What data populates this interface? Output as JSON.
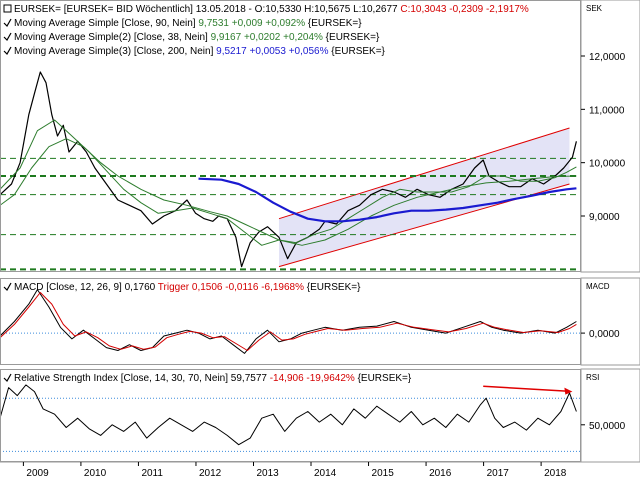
{
  "chart_data": [
    {
      "type": "line",
      "panel": "price",
      "axis_title": "SEK",
      "legend": [
        {
          "text": "EURSEK= [EURSEK= BID Wöchentlich] 13.05.2018 - O:10,5330 H:10,5675 L:10,2677 ",
          "text_colored": "C:10,3043 -0,2309 -2,1917%",
          "color": "#d40000",
          "checkbox": false
        },
        {
          "text": "Moving Average Simple [Close, 90, Nein] ",
          "text_colored": "9,7531 +0,009 +0,092%",
          "tail": " {EURSEK=}",
          "color": "#2e7d2e",
          "checkbox": true
        },
        {
          "text": "Moving Average Simple(2) [Close, 38, Nein] ",
          "text_colored": "9,9167 +0,0202 +0,204%",
          "tail": " {EURSEK=}",
          "color": "#2e7d2e",
          "checkbox": true
        },
        {
          "text": "Moving Average Simple(3) [Close, 200, Nein] ",
          "text_colored": "9,5217 +0,0053 +0,056%",
          "tail": " {EURSEK=}",
          "color": "#1a1ad0",
          "checkbox": true
        }
      ],
      "y_ticks": [
        {
          "value": 12,
          "label": "12,0000"
        },
        {
          "value": 11,
          "label": "11,0000"
        },
        {
          "value": 10,
          "label": "10,0000"
        },
        {
          "value": 9,
          "label": "9,0000"
        }
      ],
      "ylim": [
        7.95,
        13.05
      ],
      "grid": false,
      "horizontal_levels": [
        10.08,
        9.75,
        9.4,
        8.65,
        8.0
      ],
      "series": [
        {
          "id": "price",
          "color": "#000000",
          "x": [
            2008.35,
            2008.55,
            2008.7,
            2008.85,
            2008.95,
            2009.05,
            2009.15,
            2009.25,
            2009.35,
            2009.45,
            2009.55,
            2009.7,
            2009.85,
            2010.0,
            2010.2,
            2010.4,
            2010.6,
            2010.8,
            2011.0,
            2011.2,
            2011.4,
            2011.6,
            2011.75,
            2011.9,
            2012.05,
            2012.15,
            2012.3,
            2012.45,
            2012.55,
            2012.7,
            2012.85,
            2013.0,
            2013.2,
            2013.35,
            2013.5,
            2013.7,
            2013.9,
            2014.0,
            2014.2,
            2014.4,
            2014.6,
            2014.8,
            2015.0,
            2015.2,
            2015.4,
            2015.6,
            2015.8,
            2016.0,
            2016.2,
            2016.4,
            2016.6,
            2016.75,
            2016.85,
            2017.0,
            2017.2,
            2017.4,
            2017.6,
            2017.8,
            2018.0,
            2018.15,
            2018.3,
            2018.37
          ],
          "y": [
            9.4,
            9.6,
            10.0,
            10.9,
            11.3,
            11.7,
            11.5,
            10.9,
            10.5,
            10.7,
            10.2,
            10.4,
            10.2,
            9.9,
            9.6,
            9.3,
            9.2,
            9.1,
            8.85,
            9.0,
            9.1,
            9.3,
            9.05,
            8.95,
            8.9,
            9.0,
            8.95,
            8.6,
            8.05,
            8.5,
            8.7,
            8.8,
            8.6,
            8.2,
            8.5,
            8.6,
            8.75,
            8.9,
            8.85,
            9.1,
            9.2,
            9.4,
            9.5,
            9.45,
            9.35,
            9.5,
            9.4,
            9.35,
            9.5,
            9.6,
            9.9,
            10.05,
            9.75,
            9.65,
            9.55,
            9.55,
            9.7,
            9.6,
            9.75,
            9.9,
            10.1,
            10.4
          ]
        },
        {
          "id": "ma90",
          "color": "#2e7d2e",
          "x": [
            2008.35,
            2008.6,
            2008.9,
            2009.2,
            2009.5,
            2009.8,
            2010.1,
            2010.4,
            2010.8,
            2011.2,
            2011.6,
            2012.0,
            2012.3,
            2012.6,
            2012.9,
            2013.2,
            2013.6,
            2014.0,
            2014.4,
            2014.8,
            2015.2,
            2015.6,
            2016.0,
            2016.4,
            2016.8,
            2017.2,
            2017.6,
            2018.0,
            2018.37
          ],
          "y": [
            9.2,
            9.4,
            9.9,
            10.3,
            10.45,
            10.3,
            10.0,
            9.75,
            9.5,
            9.3,
            9.2,
            9.08,
            9.0,
            8.85,
            8.7,
            8.55,
            8.45,
            8.55,
            8.75,
            9.0,
            9.2,
            9.35,
            9.45,
            9.55,
            9.62,
            9.65,
            9.7,
            9.74,
            9.75
          ]
        },
        {
          "id": "ma38",
          "color": "#2e7d2e",
          "x": [
            2008.35,
            2008.7,
            2009.0,
            2009.3,
            2009.6,
            2009.9,
            2010.2,
            2010.5,
            2010.8,
            2011.1,
            2011.4,
            2011.7,
            2012.0,
            2012.3,
            2012.6,
            2012.9,
            2013.2,
            2013.5,
            2013.8,
            2014.1,
            2014.4,
            2014.7,
            2015.0,
            2015.3,
            2015.6,
            2015.9,
            2016.2,
            2016.5,
            2016.8,
            2017.1,
            2017.4,
            2017.7,
            2018.0,
            2018.2,
            2018.37
          ],
          "y": [
            9.5,
            9.9,
            10.6,
            10.8,
            10.5,
            10.2,
            9.85,
            9.5,
            9.25,
            9.05,
            9.1,
            9.15,
            9.05,
            8.95,
            8.7,
            8.45,
            8.55,
            8.5,
            8.65,
            8.75,
            8.95,
            9.15,
            9.35,
            9.5,
            9.45,
            9.45,
            9.45,
            9.55,
            9.75,
            9.75,
            9.65,
            9.65,
            9.72,
            9.82,
            9.92
          ]
        },
        {
          "id": "ma200",
          "color": "#1a1ad0",
          "x": [
            2011.8,
            2012.2,
            2012.5,
            2012.8,
            2013.1,
            2013.4,
            2013.7,
            2014.0,
            2014.3,
            2014.6,
            2014.9,
            2015.2,
            2015.5,
            2015.8,
            2016.1,
            2016.4,
            2016.7,
            2017.0,
            2017.3,
            2017.6,
            2017.9,
            2018.2,
            2018.37
          ],
          "y": [
            9.7,
            9.68,
            9.6,
            9.45,
            9.25,
            9.08,
            8.95,
            8.9,
            8.9,
            8.93,
            8.98,
            9.05,
            9.1,
            9.1,
            9.12,
            9.15,
            9.2,
            9.25,
            9.32,
            9.38,
            9.45,
            9.5,
            9.52
          ]
        }
      ],
      "channel": {
        "x0": 2013.2,
        "x1": 2018.25,
        "upper": [
          8.95,
          10.65
        ],
        "lower": [
          8.05,
          9.6
        ],
        "fill": "#dcdcf4",
        "color": "#e00000"
      }
    },
    {
      "type": "line",
      "panel": "macd",
      "axis_title": "MACD",
      "legend": [
        {
          "text": "MACD [Close, 12, 26, 9] 0,1760 ",
          "text_colored": "Trigger 0,1506 -0,0116 -6,1968%",
          "tail": " {EURSEK=}",
          "color": "#d40000",
          "checkbox": true
        }
      ],
      "y_ticks": [
        {
          "value": 0,
          "label": "0,0000"
        }
      ],
      "ylim": [
        -0.55,
        0.95
      ],
      "series": [
        {
          "id": "macd",
          "color": "#000000",
          "x": [
            2008.35,
            2008.6,
            2008.85,
            2009.0,
            2009.2,
            2009.4,
            2009.6,
            2009.8,
            2010.0,
            2010.2,
            2010.4,
            2010.6,
            2010.8,
            2011.0,
            2011.2,
            2011.4,
            2011.6,
            2011.8,
            2012.0,
            2012.2,
            2012.4,
            2012.6,
            2012.8,
            2013.0,
            2013.2,
            2013.4,
            2013.6,
            2013.8,
            2014.0,
            2014.3,
            2014.6,
            2014.9,
            2015.2,
            2015.5,
            2015.8,
            2016.1,
            2016.4,
            2016.7,
            2016.9,
            2017.1,
            2017.4,
            2017.7,
            2018.0,
            2018.2,
            2018.37
          ],
          "y": [
            -0.05,
            0.2,
            0.5,
            0.75,
            0.45,
            0.1,
            -0.1,
            0.05,
            -0.1,
            -0.25,
            -0.3,
            -0.2,
            -0.3,
            -0.25,
            -0.05,
            0.0,
            0.05,
            0.0,
            -0.1,
            -0.05,
            -0.2,
            -0.35,
            -0.1,
            0.05,
            -0.15,
            -0.1,
            0.0,
            0.05,
            0.1,
            0.05,
            0.1,
            0.12,
            0.2,
            0.1,
            0.05,
            0.0,
            0.1,
            0.2,
            0.1,
            0.05,
            0.0,
            0.05,
            0.0,
            0.1,
            0.2
          ]
        },
        {
          "id": "trigger",
          "color": "#d40000",
          "x": [
            2008.35,
            2008.6,
            2008.85,
            2009.05,
            2009.25,
            2009.45,
            2009.65,
            2009.85,
            2010.05,
            2010.25,
            2010.45,
            2010.65,
            2010.85,
            2011.05,
            2011.25,
            2011.45,
            2011.65,
            2011.85,
            2012.05,
            2012.25,
            2012.45,
            2012.65,
            2012.85,
            2013.05,
            2013.25,
            2013.45,
            2013.65,
            2013.85,
            2014.05,
            2014.35,
            2014.65,
            2014.95,
            2015.25,
            2015.55,
            2015.85,
            2016.15,
            2016.45,
            2016.75,
            2016.95,
            2017.15,
            2017.45,
            2017.75,
            2018.05,
            2018.25,
            2018.37
          ],
          "y": [
            -0.08,
            0.15,
            0.45,
            0.7,
            0.5,
            0.15,
            -0.05,
            0.02,
            -0.08,
            -0.22,
            -0.28,
            -0.22,
            -0.28,
            -0.24,
            -0.08,
            -0.02,
            0.03,
            0.0,
            -0.08,
            -0.06,
            -0.18,
            -0.3,
            -0.12,
            0.02,
            -0.12,
            -0.1,
            -0.02,
            0.03,
            0.08,
            0.05,
            0.08,
            0.1,
            0.17,
            0.1,
            0.06,
            0.02,
            0.08,
            0.17,
            0.1,
            0.06,
            0.01,
            0.04,
            0.01,
            0.08,
            0.15
          ]
        }
      ]
    },
    {
      "type": "line",
      "panel": "rsi",
      "axis_title": "RSI",
      "legend": [
        {
          "text": "Relative Strength Index [Close, 14, 30, 70, Nein] 59,7577 ",
          "text_colored": "-14,906 -19,9642%",
          "tail": " {EURSEK=}",
          "color": "#d40000",
          "checkbox": true
        }
      ],
      "y_ticks": [
        {
          "value": 50,
          "label": "50,0000"
        }
      ],
      "ylim": [
        22,
        92
      ],
      "levels": [
        70,
        30
      ],
      "series": [
        {
          "id": "rsi",
          "color": "#000000",
          "x": [
            2008.35,
            2008.5,
            2008.65,
            2008.8,
            2008.95,
            2009.1,
            2009.3,
            2009.5,
            2009.7,
            2009.9,
            2010.1,
            2010.3,
            2010.5,
            2010.7,
            2010.9,
            2011.1,
            2011.3,
            2011.5,
            2011.7,
            2011.9,
            2012.1,
            2012.3,
            2012.5,
            2012.7,
            2012.9,
            2013.1,
            2013.3,
            2013.5,
            2013.7,
            2013.9,
            2014.1,
            2014.3,
            2014.5,
            2014.7,
            2014.9,
            2015.1,
            2015.3,
            2015.5,
            2015.7,
            2015.9,
            2016.1,
            2016.3,
            2016.5,
            2016.7,
            2016.8,
            2016.95,
            2017.1,
            2017.3,
            2017.5,
            2017.7,
            2017.9,
            2018.1,
            2018.25,
            2018.37
          ],
          "y": [
            55,
            78,
            72,
            80,
            75,
            62,
            58,
            48,
            55,
            47,
            42,
            50,
            45,
            52,
            40,
            48,
            55,
            50,
            45,
            52,
            48,
            42,
            35,
            40,
            55,
            58,
            45,
            55,
            60,
            52,
            58,
            50,
            62,
            55,
            64,
            58,
            52,
            60,
            50,
            55,
            48,
            58,
            52,
            65,
            70,
            55,
            48,
            52,
            46,
            55,
            50,
            60,
            74,
            60
          ]
        }
      ],
      "annotation_arrow": {
        "x0": 2016.75,
        "y0": 79,
        "x1": 2018.3,
        "y1": 75,
        "color": "#e00000"
      }
    }
  ],
  "x_axis": {
    "labels": [
      "2009",
      "2010",
      "2011",
      "2012",
      "2013",
      "2014",
      "2015",
      "2016",
      "2017",
      "2018"
    ],
    "positions": [
      2009,
      2010,
      2011,
      2012,
      2013,
      2014,
      2015,
      2016,
      2017,
      2018
    ],
    "range": [
      2008.35,
      2018.45
    ]
  }
}
